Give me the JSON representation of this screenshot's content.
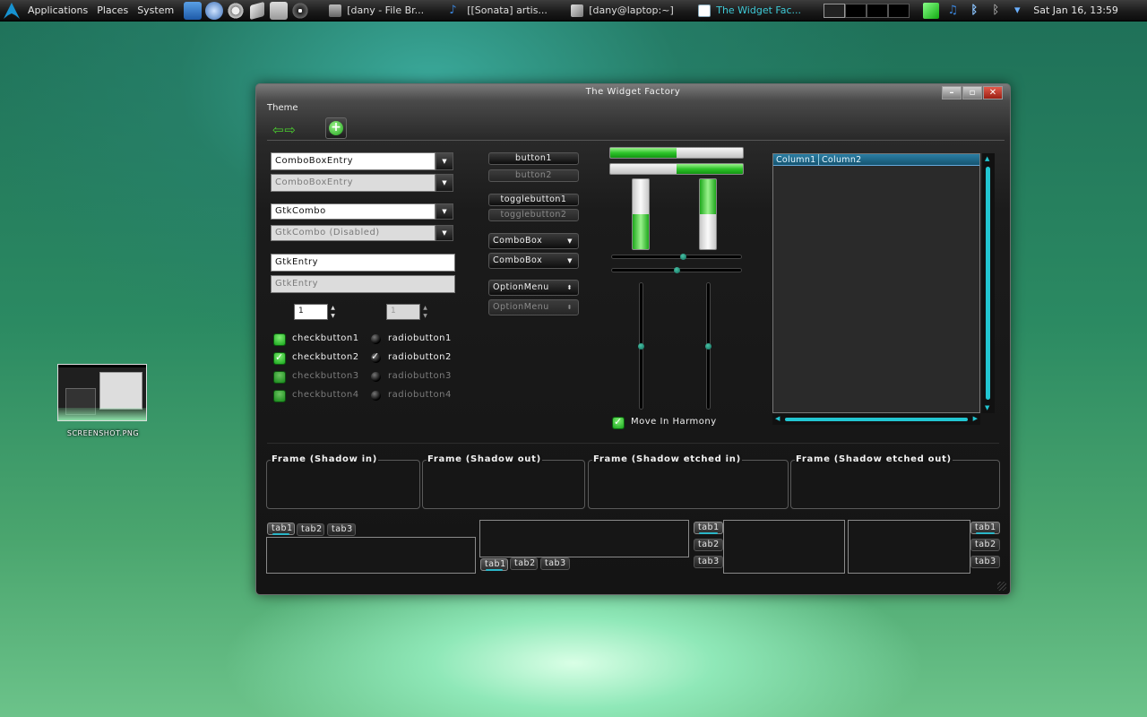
{
  "panel": {
    "menus": [
      "Applications",
      "Places",
      "System"
    ],
    "tasks": [
      {
        "label": "[dany - File Br...",
        "active": false
      },
      {
        "label": "[[Sonata] artis...",
        "active": false
      },
      {
        "label": "[dany@laptop:~]",
        "active": false
      },
      {
        "label": "The Widget Fac...",
        "active": true
      }
    ],
    "clock": "Sat Jan 16, 13:59"
  },
  "desktop": {
    "icon_label": "SCREENSHOT.PNG"
  },
  "window": {
    "title": "The Widget Factory",
    "menu": "Theme",
    "combo_entries": [
      {
        "value": "ComboBoxEntry",
        "disabled": false
      },
      {
        "value": "ComboBoxEntry",
        "disabled": true
      }
    ],
    "gtk_combos": [
      {
        "value": "GtkCombo",
        "disabled": false
      },
      {
        "value": "GtkCombo (Disabled)",
        "disabled": true
      }
    ],
    "entries": [
      {
        "value": "GtkEntry",
        "disabled": false
      },
      {
        "value": "GtkEntry",
        "disabled": true
      }
    ],
    "spins": [
      {
        "value": "1",
        "disabled": false
      },
      {
        "value": "1",
        "disabled": true
      }
    ],
    "checks": [
      {
        "label": "checkbutton1",
        "checked": false,
        "disabled": false
      },
      {
        "label": "checkbutton2",
        "checked": true,
        "disabled": false
      },
      {
        "label": "checkbutton3",
        "checked": false,
        "disabled": true
      },
      {
        "label": "checkbutton4",
        "checked": false,
        "disabled": true
      }
    ],
    "radios": [
      {
        "label": "radiobutton1",
        "checked": false,
        "disabled": false
      },
      {
        "label": "radiobutton2",
        "checked": true,
        "disabled": false
      },
      {
        "label": "radiobutton3",
        "checked": false,
        "disabled": true
      },
      {
        "label": "radiobutton4",
        "checked": false,
        "disabled": true
      }
    ],
    "buttons": [
      "button1",
      "button2"
    ],
    "toggles": [
      "togglebutton1",
      "togglebutton2"
    ],
    "comboboxes": [
      "ComboBox",
      "ComboBox"
    ],
    "option_menus": [
      "OptionMenu",
      "OptionMenu"
    ],
    "progress": {
      "h1": 0.5,
      "h2": 0.5,
      "v1": 0.5,
      "v2": 0.5
    },
    "scales": {
      "h1": 0.55,
      "h2": 0.5,
      "v1": 0.5,
      "v2": 0.5
    },
    "move_in_harmony": "Move In Harmony",
    "tree_columns": [
      "Column1",
      "Column2"
    ],
    "frames": [
      "Frame (Shadow in)",
      "Frame (Shadow out)",
      "Frame (Shadow etched in)",
      "Frame (Shadow etched out)"
    ],
    "tabs": [
      "tab1",
      "tab2",
      "tab3"
    ]
  },
  "colors": {
    "accent": "#2ab6c8",
    "progress": "#2ec42a",
    "active_task": "#3ec9d6"
  }
}
